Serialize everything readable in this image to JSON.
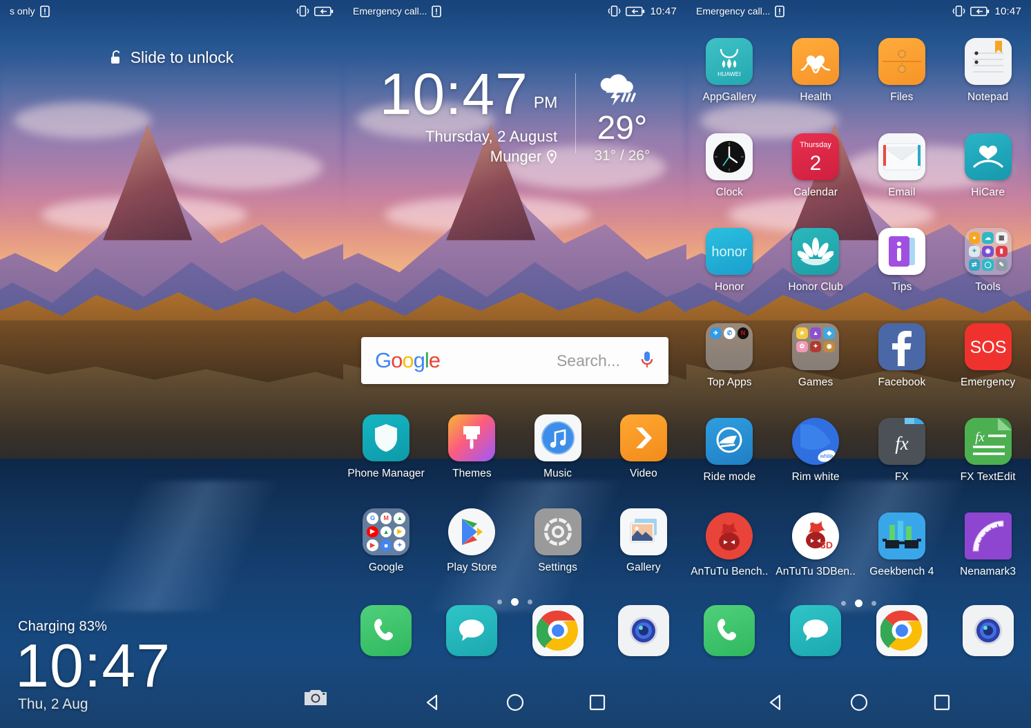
{
  "lockscreen": {
    "statusbar": {
      "carrier": "s only",
      "sim_icon": "sim-card-icon",
      "vibrate_icon": "vibrate-icon",
      "battery_icon": "battery-charging-icon"
    },
    "slide_to_unlock": "Slide to unlock",
    "lock_icon": "unlock-icon",
    "charging": "Charging 83%",
    "time": "10:47",
    "date": "Thu, 2 Aug",
    "camera_icon": "camera-icon"
  },
  "home": {
    "statusbar": {
      "carrier": "Emergency call...",
      "sim_icon": "sim-card-icon",
      "vibrate_icon": "vibrate-icon",
      "battery_icon": "battery-charging-icon",
      "time": "10:47"
    },
    "clock_widget": {
      "time": "10:47",
      "ampm": "PM",
      "date": "Thursday, 2 August",
      "location": "Munger",
      "location_icon": "location-pin-icon",
      "weather_icon": "thunderstorm-icon",
      "temperature": "29°",
      "range": "31° / 26°"
    },
    "search": {
      "brand": "Google",
      "placeholder": "Search...",
      "mic_icon": "microphone-icon"
    },
    "apps": [
      {
        "label": "Phone Manager",
        "icon": "phone-manager-icon"
      },
      {
        "label": "Themes",
        "icon": "themes-icon"
      },
      {
        "label": "Music",
        "icon": "music-icon"
      },
      {
        "label": "Video",
        "icon": "video-icon"
      },
      {
        "label": "Google",
        "icon": "google-folder-icon"
      },
      {
        "label": "Play Store",
        "icon": "play-store-icon"
      },
      {
        "label": "Settings",
        "icon": "settings-icon"
      },
      {
        "label": "Gallery",
        "icon": "gallery-icon"
      }
    ],
    "page_dots": {
      "count": 3,
      "active": 1
    },
    "dock": [
      {
        "label": "Phone",
        "icon": "phone-icon"
      },
      {
        "label": "Messages",
        "icon": "messages-icon"
      },
      {
        "label": "Chrome",
        "icon": "chrome-icon"
      },
      {
        "label": "Camera",
        "icon": "camera-app-icon"
      }
    ],
    "navbar": {
      "back": "back-icon",
      "home": "home-icon",
      "recents": "recents-icon"
    }
  },
  "home2": {
    "statusbar": {
      "carrier": "Emergency call...",
      "sim_icon": "sim-card-icon",
      "vibrate_icon": "vibrate-icon",
      "battery_icon": "battery-charging-icon",
      "time": "10:47"
    },
    "apps": [
      {
        "label": "AppGallery",
        "icon": "appgallery-icon"
      },
      {
        "label": "Health",
        "icon": "health-icon"
      },
      {
        "label": "Files",
        "icon": "files-icon"
      },
      {
        "label": "Notepad",
        "icon": "notepad-icon"
      },
      {
        "label": "Clock",
        "icon": "clock-icon"
      },
      {
        "label": "Calendar",
        "icon": "calendar-icon"
      },
      {
        "label": "Email",
        "icon": "email-icon"
      },
      {
        "label": "HiCare",
        "icon": "hicare-icon"
      },
      {
        "label": "Honor",
        "icon": "honor-icon"
      },
      {
        "label": "Honor Club",
        "icon": "honor-club-icon"
      },
      {
        "label": "Tips",
        "icon": "tips-icon"
      },
      {
        "label": "Tools",
        "icon": "tools-folder-icon"
      },
      {
        "label": "Top Apps",
        "icon": "top-apps-folder-icon"
      },
      {
        "label": "Games",
        "icon": "games-folder-icon"
      },
      {
        "label": "Facebook",
        "icon": "facebook-icon"
      },
      {
        "label": "Emergency",
        "icon": "emergency-sos-icon"
      },
      {
        "label": "Ride mode",
        "icon": "ride-mode-icon"
      },
      {
        "label": "Rim white",
        "icon": "rim-white-icon"
      },
      {
        "label": "FX",
        "icon": "fx-icon"
      },
      {
        "label": "FX TextEdit",
        "icon": "fx-textedit-icon"
      },
      {
        "label": "AnTuTu Bench..",
        "icon": "antutu-benchmark-icon"
      },
      {
        "label": "AnTuTu 3DBen..",
        "icon": "antutu-3d-benchmark-icon"
      },
      {
        "label": "Geekbench 4",
        "icon": "geekbench-icon"
      },
      {
        "label": "Nenamark3",
        "icon": "nenamark-icon"
      }
    ],
    "calendar_icon_text": {
      "weekday": "Thursday",
      "day": "2"
    },
    "emergency_text": "SOS",
    "honor_text": "honor",
    "appgallery_text": "HUAWEI",
    "page_dots": {
      "count": 3,
      "active": 1
    },
    "dock": [
      {
        "label": "Phone",
        "icon": "phone-icon"
      },
      {
        "label": "Messages",
        "icon": "messages-icon"
      },
      {
        "label": "Chrome",
        "icon": "chrome-icon"
      },
      {
        "label": "Camera",
        "icon": "camera-app-icon"
      }
    ],
    "navbar": {
      "back": "back-icon",
      "home": "home-icon",
      "recents": "recents-icon"
    }
  },
  "colors": {
    "accent_teal": "#16b6c4",
    "orange": "#f79426",
    "red": "#f0322e",
    "facebook_blue": "#4a68a8",
    "green": "#4caf50"
  }
}
